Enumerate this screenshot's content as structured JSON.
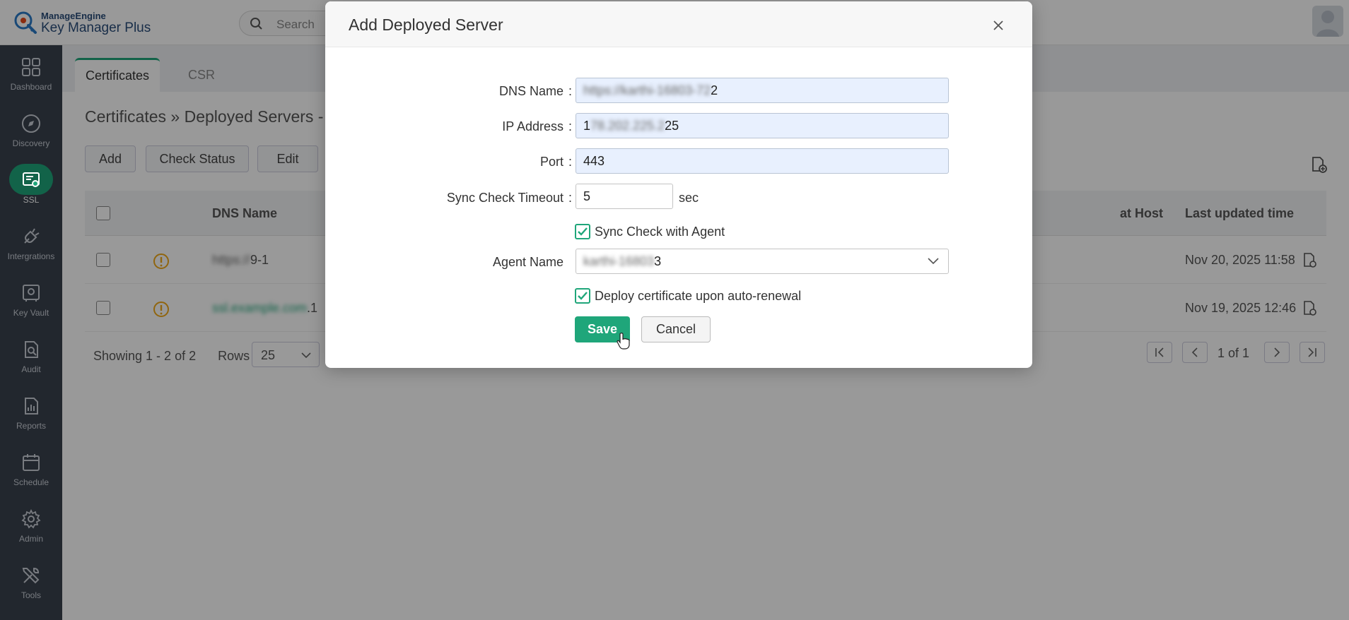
{
  "app": {
    "brand": "ManageEngine",
    "product": "Key Manager Plus",
    "search_placeholder": "Search"
  },
  "sidebar": {
    "items": [
      {
        "label": "Dashboard",
        "icon": "dashboard-icon"
      },
      {
        "label": "Discovery",
        "icon": "compass-icon"
      },
      {
        "label": "SSL",
        "icon": "certificate-icon",
        "active": true
      },
      {
        "label": "Intergrations",
        "icon": "plug-icon"
      },
      {
        "label": "Key Vault",
        "icon": "vault-icon"
      },
      {
        "label": "Audit",
        "icon": "audit-icon"
      },
      {
        "label": "Reports",
        "icon": "reports-icon"
      },
      {
        "label": "Schedule",
        "icon": "calendar-icon"
      },
      {
        "label": "Admin",
        "icon": "gear-icon"
      },
      {
        "label": "Tools",
        "icon": "tools-icon"
      }
    ]
  },
  "tabs": [
    {
      "label": "Certificates",
      "active": true
    },
    {
      "label": "CSR",
      "active": false
    }
  ],
  "breadcrumb": "Certificates » Deployed Servers -",
  "toolbar": {
    "add": "Add",
    "check_status": "Check Status",
    "edit": "Edit"
  },
  "table": {
    "headers": {
      "dns_name": "DNS Name",
      "at_host": "at Host",
      "last_updated": "Last updated time"
    },
    "rows": [
      {
        "dns_prefix": "https://",
        "dns_suffix": "9-1",
        "last_updated": "Nov 20, 2025 11:58"
      },
      {
        "dns_prefix": "ssl.example.com",
        "dns_suffix": ".1",
        "last_updated": "Nov 19, 2025 12:46"
      }
    ]
  },
  "footer": {
    "showing": "Showing 1 - 2 of 2",
    "rows_label": "Rows",
    "rows_value": "25",
    "page": "1 of 1"
  },
  "modal": {
    "title": "Add Deployed Server",
    "dns_label": "DNS Name",
    "dns_value_hidden": "https://karthi-16803-72",
    "dns_value_visible": "2",
    "ip_label": "IP Address",
    "ip_value_first": "1",
    "ip_value_hidden": "78.202.225.2",
    "ip_value_visible": "25",
    "port_label": "Port",
    "port_value": "443",
    "timeout_label": "Sync Check Timeout",
    "timeout_value": "5",
    "timeout_unit": "sec",
    "sync_agent_label": "Sync Check with Agent",
    "agent_label": "Agent Name",
    "agent_value_hidden": "karthi-16803",
    "agent_value_visible": "3",
    "deploy_label": "Deploy certificate upon auto-renewal",
    "save": "Save",
    "cancel": "Cancel",
    "colon": ":"
  },
  "colors": {
    "accent": "#1fa67a",
    "sidebar_bg": "#39424e",
    "warning": "#f0a818"
  }
}
